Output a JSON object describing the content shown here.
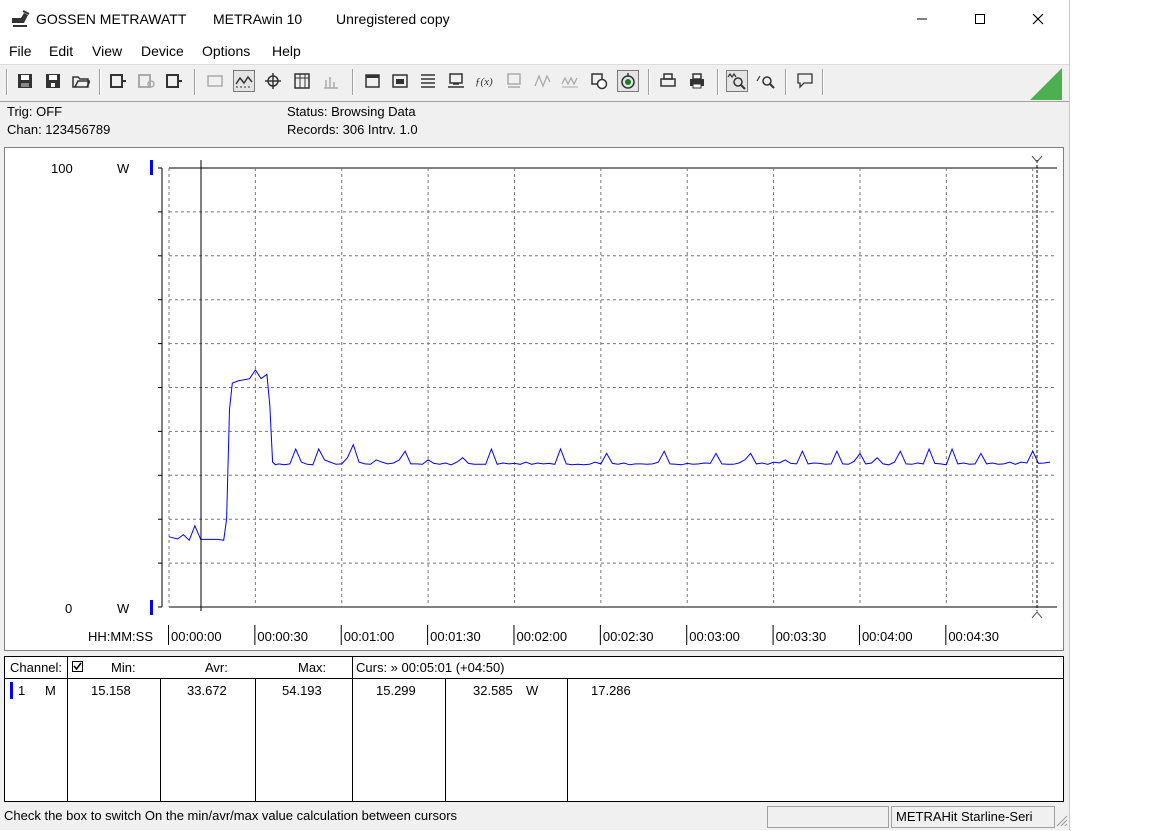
{
  "window": {
    "brand": "GOSSEN METRAWATT",
    "app": "METRAwin 10",
    "license": "Unregistered copy"
  },
  "menu": [
    "File",
    "Edit",
    "View",
    "Device",
    "Options",
    "Help"
  ],
  "info": {
    "trig": "Trig: OFF",
    "chan": "Chan:  123456789",
    "status": "Status:   Browsing Data",
    "records": "Records: 306  Intrv. 1.0"
  },
  "chart": {
    "y_top_label": "100",
    "y_bottom_label": "0",
    "y_unit": "W",
    "x_axis_title": "HH:MM:SS",
    "x_ticks": [
      "00:00:00",
      "00:00:30",
      "00:01:00",
      "00:01:30",
      "00:02:00",
      "00:02:30",
      "00:03:00",
      "00:03:30",
      "00:04:00",
      "00:04:30"
    ],
    "series_color": "#0000ff"
  },
  "chart_data": {
    "type": "line",
    "ylim": [
      0,
      100
    ],
    "xlim_seconds": [
      0,
      306
    ],
    "series": [
      {
        "x": [
          0,
          3,
          5,
          7,
          9,
          11,
          13,
          15,
          17,
          19,
          20,
          21,
          22,
          24,
          28,
          30,
          32,
          34,
          35,
          36,
          37,
          38,
          39,
          40,
          42,
          44,
          46,
          48,
          50,
          52,
          54,
          56,
          58,
          60,
          62,
          64,
          66,
          68,
          70,
          72,
          74,
          76,
          78,
          80,
          82,
          84,
          86,
          88,
          90,
          92,
          94,
          96,
          98,
          100,
          102,
          104,
          106,
          108,
          110,
          112,
          114,
          116,
          118,
          120,
          122,
          124,
          126,
          128,
          130,
          132,
          134,
          136,
          138,
          140,
          142,
          144,
          146,
          148,
          150,
          152,
          154,
          156,
          158,
          160,
          162,
          164,
          166,
          168,
          170,
          172,
          174,
          176,
          178,
          180,
          182,
          184,
          186,
          188,
          190,
          192,
          194,
          196,
          198,
          200,
          202,
          204,
          206,
          208,
          210,
          212,
          214,
          216,
          218,
          220,
          222,
          224,
          226,
          228,
          230,
          232,
          234,
          236,
          238,
          240,
          242,
          244,
          246,
          248,
          250,
          252,
          254,
          256,
          258,
          260,
          262,
          264,
          266,
          268,
          270,
          272,
          274,
          276,
          278,
          280,
          282,
          284,
          286,
          288,
          290,
          292,
          294,
          296,
          298,
          300,
          302,
          304,
          306
        ],
        "y": [
          16,
          15.5,
          16.5,
          15.2,
          18.5,
          15.4,
          15.4,
          15.4,
          15.4,
          15.2,
          20,
          45,
          51,
          51.5,
          52,
          54,
          52,
          53,
          46,
          33,
          32.4,
          32.6,
          32.5,
          32.4,
          32.6,
          36,
          33,
          32.5,
          32.4,
          36,
          33.5,
          33,
          32.5,
          32.6,
          34,
          37,
          33,
          32.6,
          32.5,
          33.5,
          33,
          32.6,
          32.8,
          33.5,
          35.5,
          32.6,
          32.6,
          32.5,
          33.5,
          32.7,
          32.5,
          32.8,
          32.4,
          33,
          34,
          32.7,
          32.5,
          32.5,
          32.5,
          36,
          32.5,
          32.8,
          32.6,
          32.7,
          32.5,
          33,
          32.5,
          32.8,
          32.6,
          32.7,
          32.5,
          36,
          32.6,
          32.4,
          32.5,
          32.4,
          32.5,
          33,
          32.6,
          35,
          32.7,
          32.5,
          32.8,
          32.4,
          32.6,
          32.6,
          32.5,
          32.6,
          33,
          35.5,
          32.6,
          32.5,
          32.4,
          32.7,
          32.5,
          32.6,
          32.8,
          32.7,
          35,
          32.6,
          32.5,
          32.5,
          32.8,
          33.5,
          35,
          32.6,
          32.8,
          32.5,
          33,
          32.8,
          33.5,
          32.7,
          32.6,
          35.5,
          32.6,
          32.8,
          32.7,
          32.5,
          32.6,
          35.5,
          32.6,
          32.5,
          33.2,
          35,
          32.6,
          32.8,
          34,
          32.6,
          32.4,
          33,
          35.5,
          32.6,
          32.5,
          32.8,
          32.6,
          36,
          32.7,
          32.6,
          32.4,
          36,
          32.6,
          32.8,
          32.5,
          32.6,
          35,
          32.6,
          32.8,
          32.5,
          32.6,
          33,
          32.5,
          33,
          32.8,
          35.5,
          32.7,
          32.8,
          33
        ]
      }
    ]
  },
  "table": {
    "headers": {
      "channel": "Channel:",
      "min": "Min:",
      "avr": "Avr:",
      "max": "Max:",
      "curs": "Curs: » 00:05:01 (+04:50)"
    },
    "row": {
      "channel": "1",
      "mode": "M",
      "min": "15.158",
      "avr": "33.672",
      "max": "54.193",
      "c1": "15.299",
      "c2": "32.585",
      "unit": "W",
      "c3": "17.286"
    }
  },
  "statusbar": {
    "hint": "Check the box to switch On the min/avr/max value calculation between cursors",
    "device": "METRAHit Starline-Seri"
  }
}
